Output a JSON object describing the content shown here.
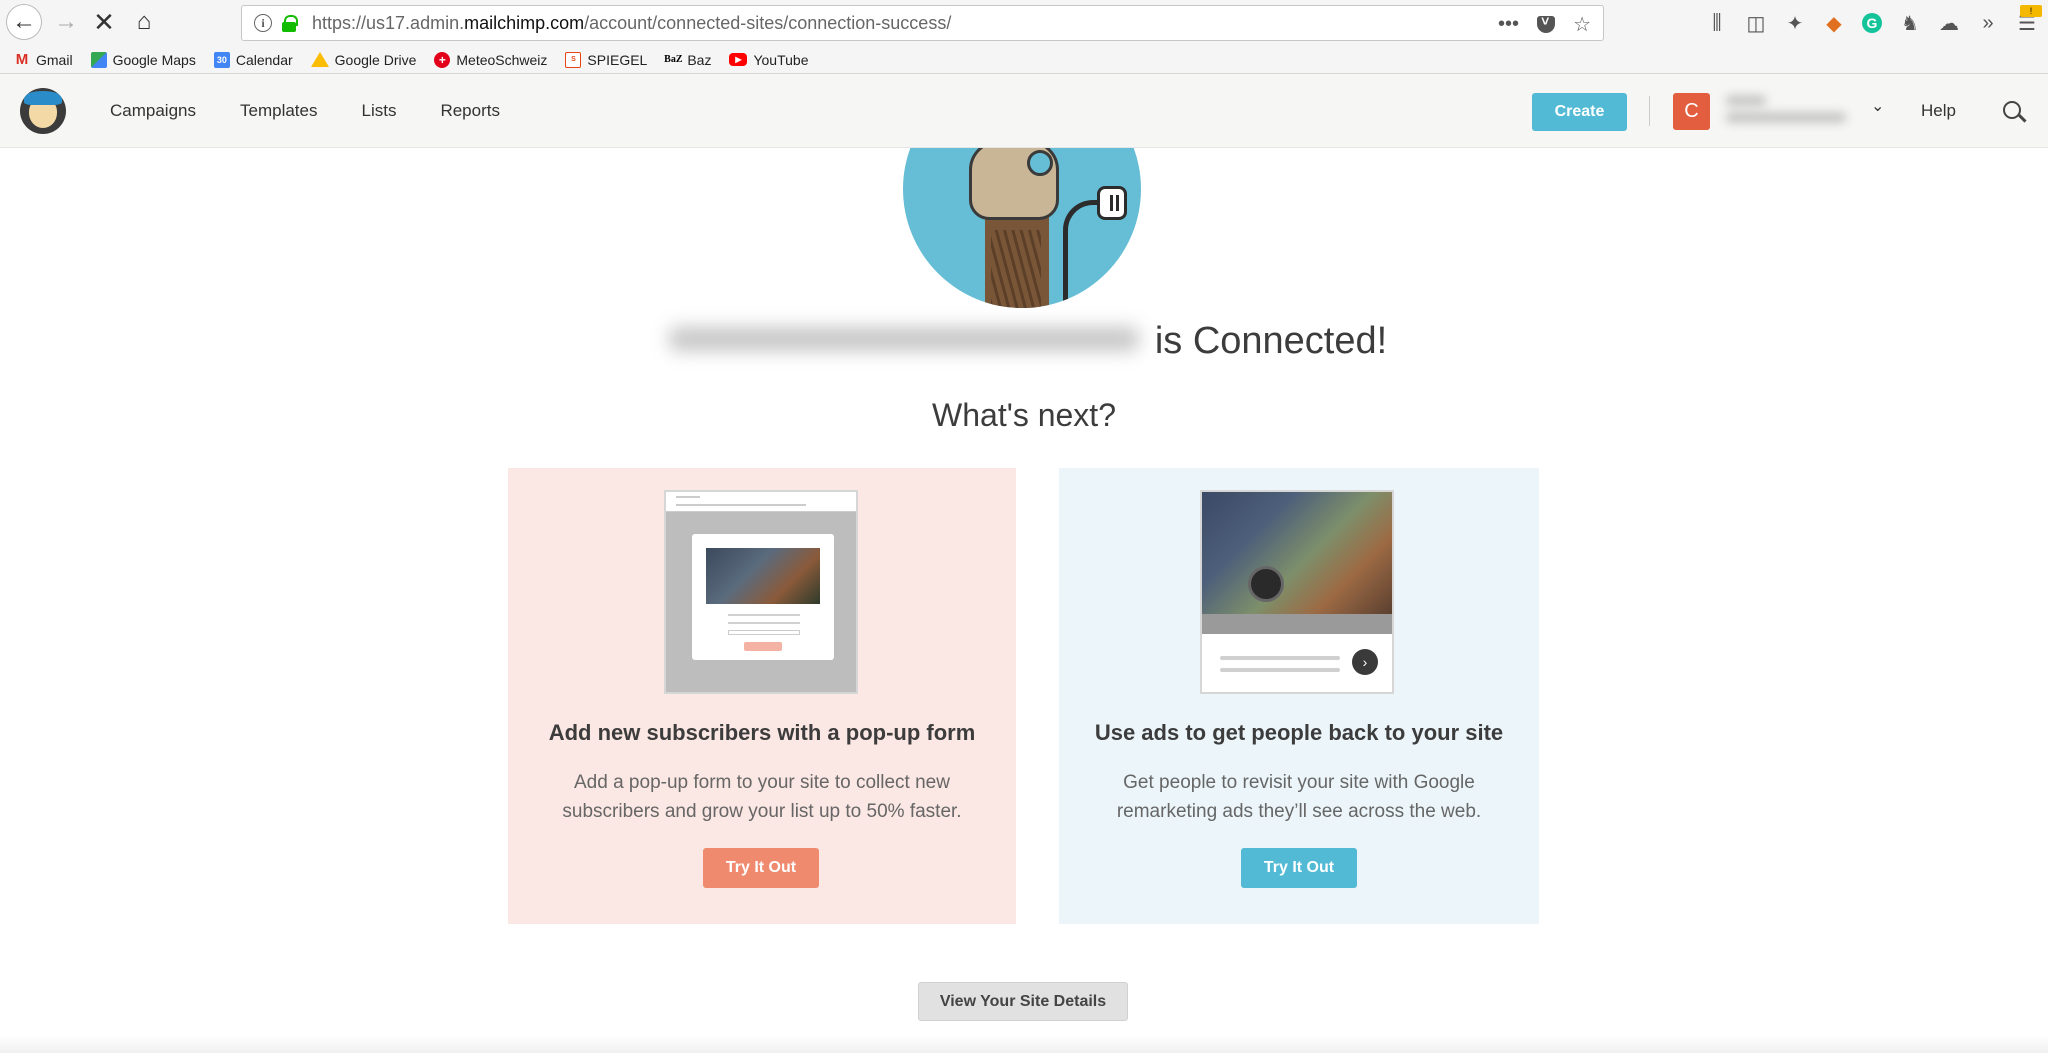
{
  "browser": {
    "url_prefix": "https://us17.admin.",
    "url_domain": "mailchimp.com",
    "url_path": "/account/connected-sites/connection-success/",
    "bookmarks": [
      {
        "label": "Gmail",
        "icon": "gmail-icon"
      },
      {
        "label": "Google Maps",
        "icon": "google-maps-icon"
      },
      {
        "label": "Calendar",
        "icon": "calendar-icon"
      },
      {
        "label": "Google Drive",
        "icon": "google-drive-icon"
      },
      {
        "label": "MeteoSchweiz",
        "icon": "meteoschweiz-icon"
      },
      {
        "label": "SPIEGEL",
        "icon": "spiegel-icon"
      },
      {
        "label": "Baz",
        "icon": "baz-icon"
      },
      {
        "label": "YouTube",
        "icon": "youtube-icon"
      }
    ],
    "calendar_day": "30",
    "menu_badge": "!"
  },
  "header": {
    "nav": [
      "Campaigns",
      "Templates",
      "Lists",
      "Reports"
    ],
    "create_label": "Create",
    "avatar_letter": "C",
    "help_label": "Help"
  },
  "main": {
    "connected_suffix": "is Connected!",
    "whats_next": "What's next?",
    "cards": [
      {
        "title": "Add new subscribers with a pop-up form",
        "description": "Add a pop-up form to your site to collect new subscribers and grow your list up to 50% faster.",
        "button": "Try It Out",
        "color": "#ef8a6f"
      },
      {
        "title": "Use ads to get people back to your site",
        "description": "Get people to revisit your site with Google remarketing ads they’ll see across the web.",
        "button": "Try It Out",
        "color": "#52bad5"
      }
    ],
    "details_button": "View Your Site Details"
  }
}
